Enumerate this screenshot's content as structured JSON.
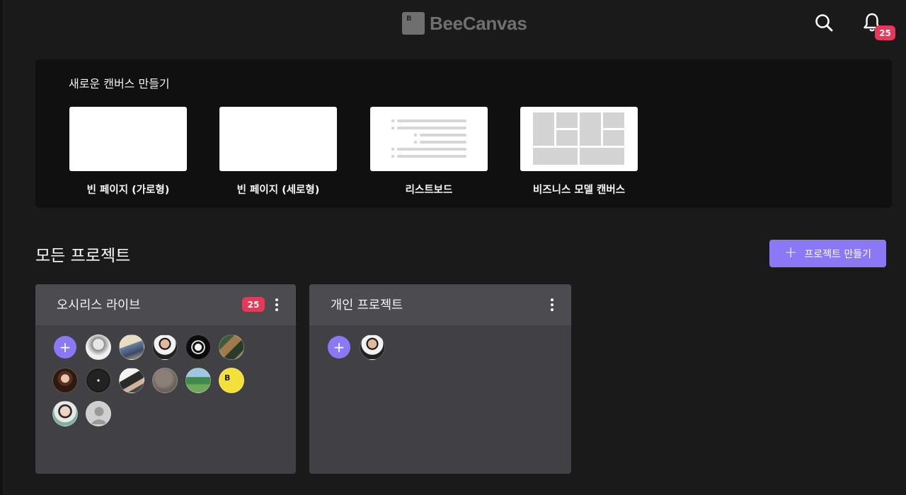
{
  "header": {
    "logo_mark": "B",
    "logo_text": "BeeCanvas",
    "notification_count": "25"
  },
  "new_canvas": {
    "title": "새로운 캔버스 만들기",
    "templates": [
      {
        "label": "빈 페이지 (가로형)",
        "type": "blank"
      },
      {
        "label": "빈 페이지 (세로형)",
        "type": "blank"
      },
      {
        "label": "리스트보드",
        "type": "listboard"
      },
      {
        "label": "비즈니스 모델 캔버스",
        "type": "bmc"
      }
    ]
  },
  "projects": {
    "title": "모든 프로젝트",
    "create_label": "프로젝트 만들기",
    "create_icon": "+",
    "add_member_icon": "+",
    "items": [
      {
        "name": "오시리스 라이브",
        "badge": "25",
        "member_count": 14
      },
      {
        "name": "개인 프로젝트",
        "badge": "",
        "member_count": 1
      }
    ]
  },
  "colors": {
    "accent": "#8b78f7",
    "badge": "#e8385a",
    "background": "#1a1a1a"
  }
}
